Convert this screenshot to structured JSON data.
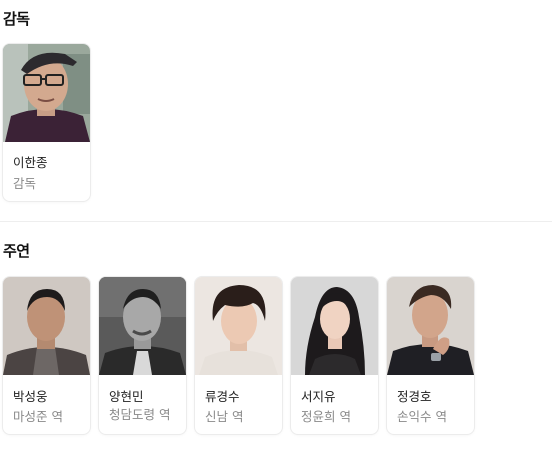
{
  "sections": {
    "director": {
      "title": "감독",
      "people": [
        {
          "name": "이한종",
          "role": "감독"
        }
      ]
    },
    "cast": {
      "title": "주연",
      "people": [
        {
          "name": "박성웅",
          "role": "마성준 역"
        },
        {
          "name": "양현민",
          "role": "청담도령 역"
        },
        {
          "name": "류경수",
          "role": "신남 역"
        },
        {
          "name": "서지유",
          "role": "정윤희 역"
        },
        {
          "name": "정경호",
          "role": "손익수 역"
        }
      ]
    }
  }
}
